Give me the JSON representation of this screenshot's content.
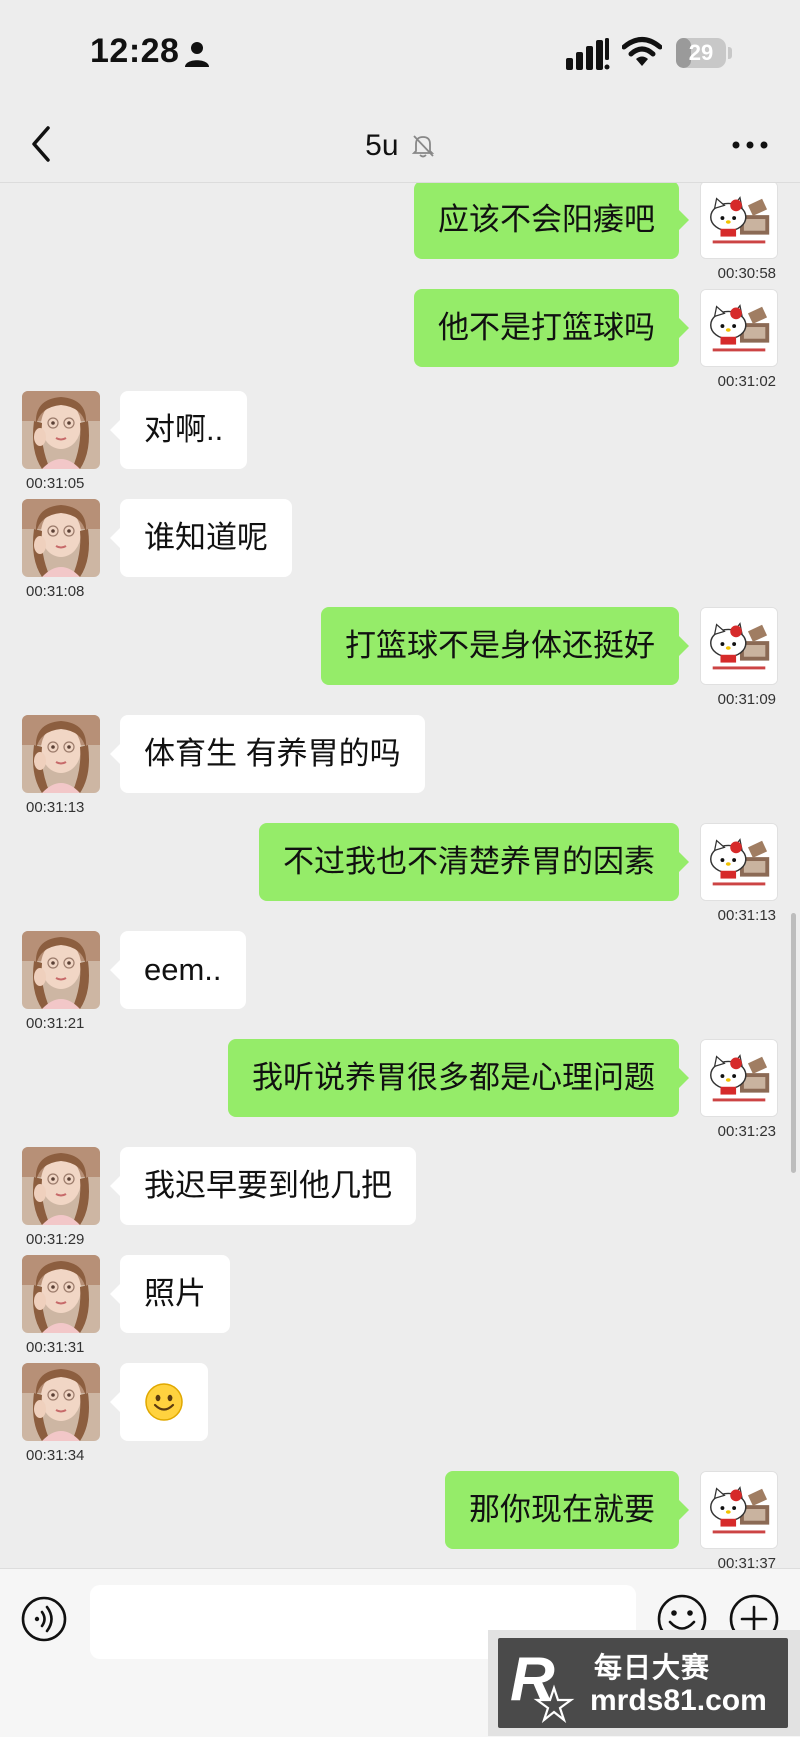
{
  "status_bar": {
    "time": "12:28",
    "battery": "29",
    "battery_level": 0.29
  },
  "header": {
    "title": "5u",
    "icons": {
      "back": "chevron-left-icon",
      "mute": "bell-off-icon",
      "more": "more-horizontal-icon"
    }
  },
  "messages": [
    {
      "side": "out",
      "text": "应该不会阳痿吧",
      "time": "00:30:58"
    },
    {
      "side": "out",
      "text": "他不是打篮球吗",
      "time": "00:31:02"
    },
    {
      "side": "in",
      "text": "对啊..",
      "time": "00:31:05"
    },
    {
      "side": "in",
      "text": "谁知道呢",
      "time": "00:31:08"
    },
    {
      "side": "out",
      "text": "打篮球不是身体还挺好",
      "time": "00:31:09"
    },
    {
      "side": "in",
      "text": "体育生 有养胃的吗",
      "time": "00:31:13"
    },
    {
      "side": "out",
      "text": "不过我也不清楚养胃的因素",
      "time": "00:31:13"
    },
    {
      "side": "in",
      "text": "eem..",
      "time": "00:31:21"
    },
    {
      "side": "out",
      "text": "我听说养胃很多都是心理问题",
      "time": "00:31:23"
    },
    {
      "side": "in",
      "text": "我迟早要到他几把",
      "time": "00:31:29"
    },
    {
      "side": "in",
      "text": "照片",
      "time": "00:31:31"
    },
    {
      "side": "in",
      "text": "",
      "emoji": "smile-emoji",
      "time": "00:31:34"
    },
    {
      "side": "out",
      "text": "那你现在就要",
      "time": "00:31:37"
    }
  ],
  "input_bar": {
    "placeholder": "",
    "icons": {
      "voice": "voice-icon",
      "emoji": "emoji-icon",
      "plus": "plus-icon"
    }
  },
  "watermark": {
    "logo_letter": "R",
    "title": "每日大赛",
    "url": "mrds81.com"
  },
  "colors": {
    "background": "#ededed",
    "outgoing_bubble": "#95ec69",
    "incoming_bubble": "#ffffff"
  }
}
